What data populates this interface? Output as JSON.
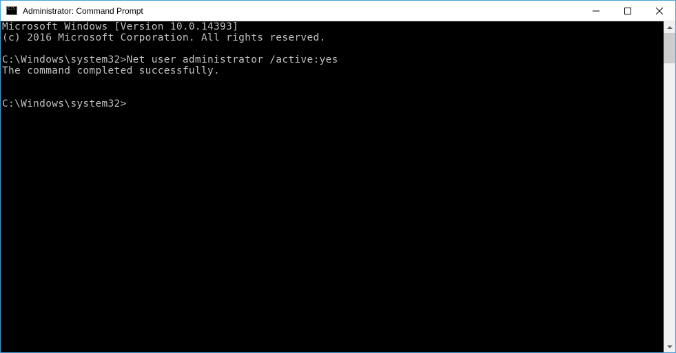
{
  "window": {
    "title": "Administrator: Command Prompt"
  },
  "terminal": {
    "lines": [
      "Microsoft Windows [Version 10.0.14393]",
      "(c) 2016 Microsoft Corporation. All rights reserved.",
      "",
      "C:\\Windows\\system32>Net user administrator /active:yes",
      "The command completed successfully.",
      "",
      "",
      "C:\\Windows\\system32>"
    ]
  }
}
